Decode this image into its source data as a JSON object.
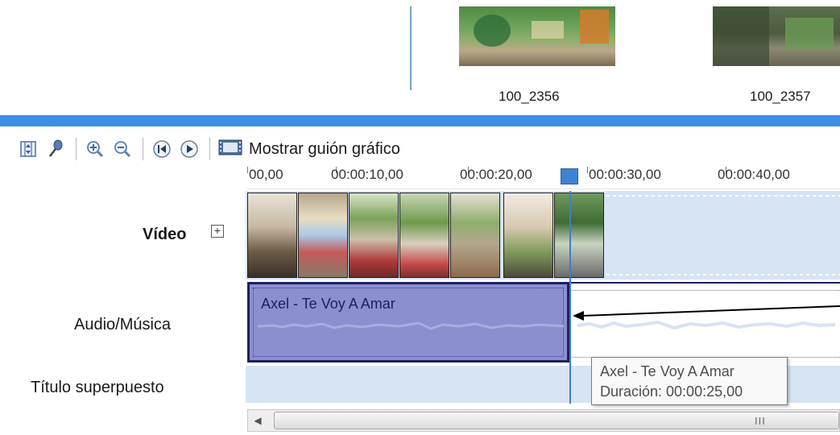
{
  "collection": {
    "clips": [
      {
        "label": "100_2356"
      },
      {
        "label": "100_2357"
      }
    ]
  },
  "toolbar": {
    "buttons": [
      {
        "icon": "timeline-settings-icon"
      },
      {
        "icon": "narrate-microphone-icon"
      },
      {
        "icon": "zoom-in-icon"
      },
      {
        "icon": "zoom-out-icon"
      },
      {
        "icon": "rewind-icon"
      },
      {
        "icon": "play-icon"
      }
    ],
    "storyboard_label": "Mostrar guión gráfico"
  },
  "ruler": {
    "ticks": [
      "00,00",
      "00:00:10,00",
      "00:00:20,00",
      "00:00:30,00",
      "00:00:40,00"
    ]
  },
  "tracks": {
    "video_label": "Vídeo",
    "expand_symbol": "+",
    "audio_label": "Audio/Música",
    "title_label": "Título superpuesto"
  },
  "audio_clip": {
    "name": "Axel - Te Voy A Amar"
  },
  "tooltip": {
    "line1": "Axel - Te Voy A Amar",
    "line2": "Duración: 00:00:25,00"
  },
  "scrollbar": {
    "grip": "III"
  },
  "colors": {
    "accent_blue": "#3d8ee6",
    "audio_clip": "#8b8fd0",
    "track_bg": "#d7e4f3",
    "playhead": "#3d7fc9"
  }
}
